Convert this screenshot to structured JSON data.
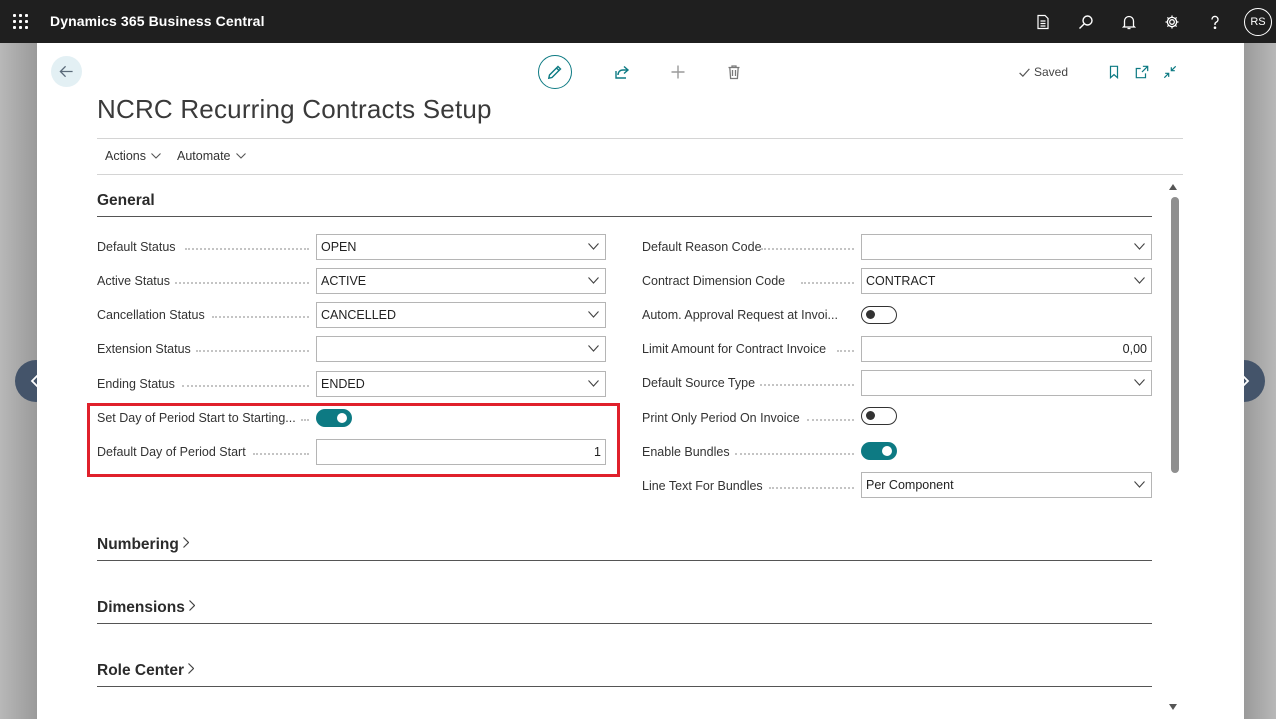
{
  "app": {
    "title": "Dynamics 365 Business Central",
    "user_initials": "RS",
    "top_icons": [
      "waffle-icon",
      "document-icon",
      "search-icon",
      "bell-icon",
      "gear-icon",
      "help-icon"
    ]
  },
  "toolbar": {
    "status": "Saved",
    "center_icons": [
      "pencil-icon",
      "share-icon",
      "plus-icon",
      "trash-icon"
    ],
    "right_icons": [
      "bookmark-icon",
      "open-new-window-icon",
      "collapse-icon"
    ]
  },
  "page": {
    "title": "NCRC Recurring Contracts Setup",
    "actions": [
      "Actions",
      "Automate"
    ]
  },
  "general": {
    "heading": "General",
    "left_fields": [
      {
        "label": "Default Status",
        "type": "select",
        "value": "OPEN"
      },
      {
        "label": "Active Status",
        "type": "select",
        "value": "ACTIVE"
      },
      {
        "label": "Cancellation Status",
        "type": "select",
        "value": "CANCELLED"
      },
      {
        "label": "Extension Status",
        "type": "select",
        "value": ""
      },
      {
        "label": "Ending Status",
        "type": "select",
        "value": "ENDED"
      },
      {
        "label": "Set Day of Period Start to Starting...",
        "type": "toggle",
        "value": true
      },
      {
        "label": "Default Day of Period Start",
        "type": "number",
        "value": "1"
      }
    ],
    "right_fields": [
      {
        "label": "Default Reason Code",
        "type": "select",
        "value": ""
      },
      {
        "label": "Contract Dimension Code",
        "type": "select",
        "value": "CONTRACT"
      },
      {
        "label": "Autom. Approval Request at Invoi...",
        "type": "toggle",
        "value": false
      },
      {
        "label": "Limit Amount for Contract Invoice",
        "type": "number",
        "value": "0,00"
      },
      {
        "label": "Default Source Type",
        "type": "select",
        "value": ""
      },
      {
        "label": "Print Only Period On Invoice",
        "type": "toggle",
        "value": false
      },
      {
        "label": "Enable Bundles",
        "type": "toggle",
        "value": true
      },
      {
        "label": "Line Text For Bundles",
        "type": "select",
        "value": "Per Component"
      }
    ]
  },
  "sections": [
    {
      "heading": "Numbering"
    },
    {
      "heading": "Dimensions"
    },
    {
      "heading": "Role Center"
    }
  ],
  "colors": {
    "accent": "#0d7a83",
    "topbar": "#1f1f1f",
    "highlight": "#e0202b"
  }
}
